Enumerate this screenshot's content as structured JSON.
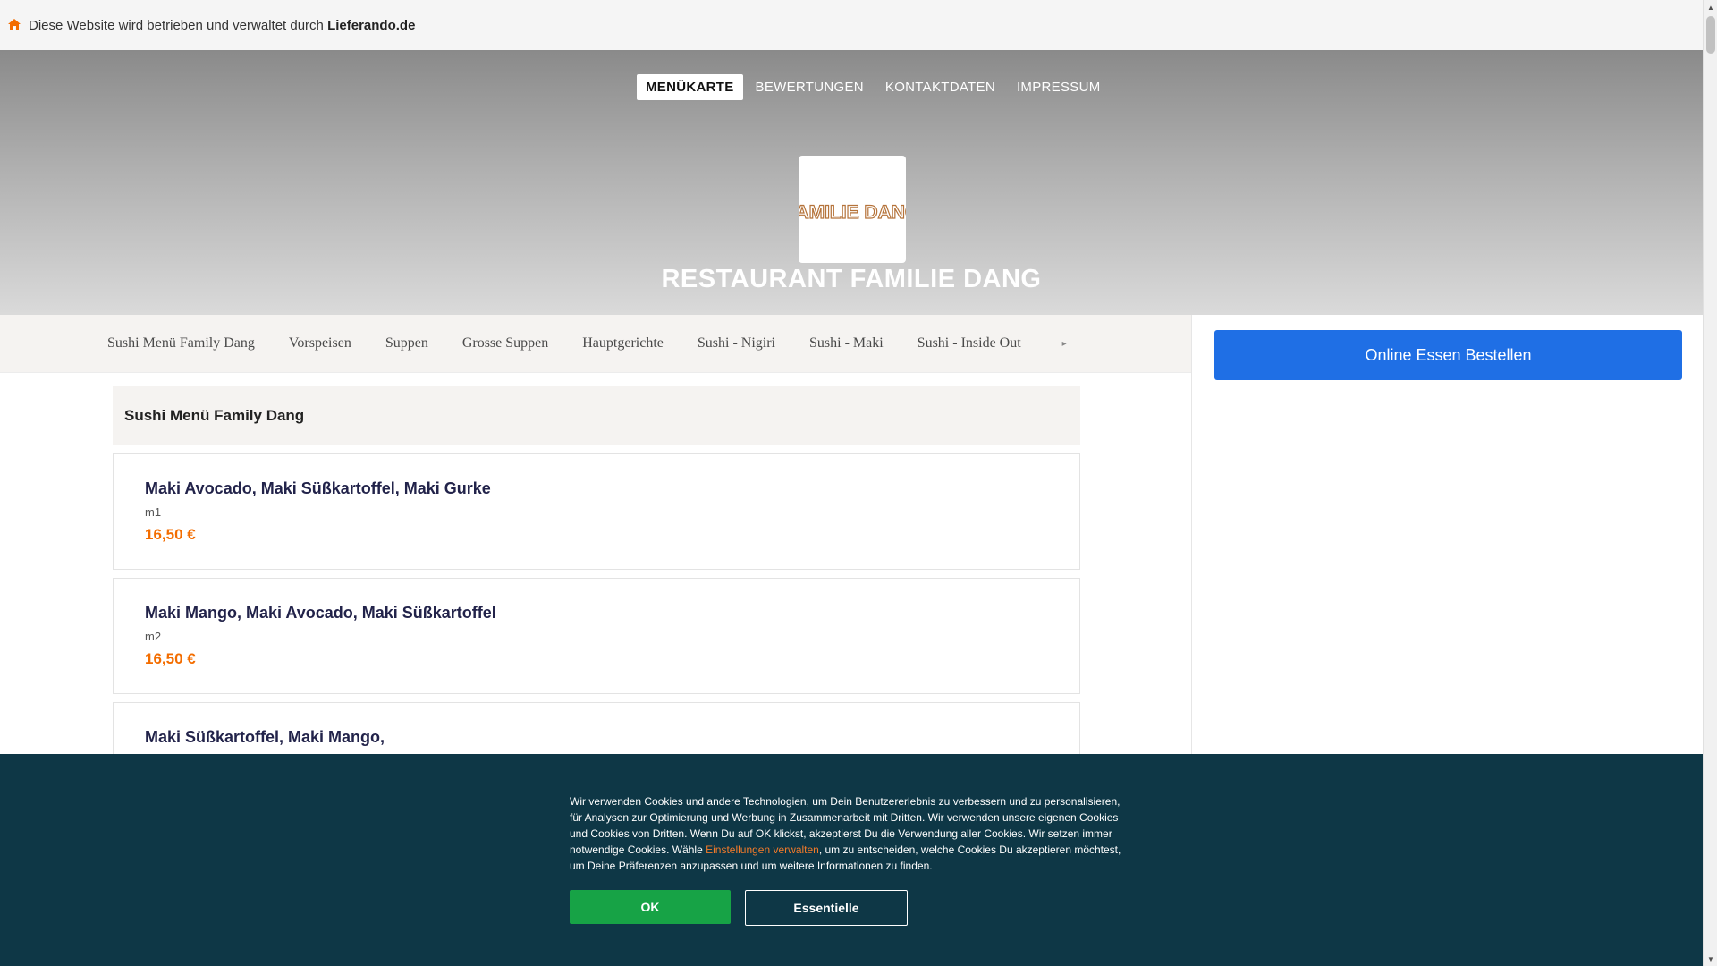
{
  "infobar": {
    "prefix": "Diese Website wird betrieben und verwaltet durch ",
    "brand": "Lieferando.de",
    "icon": "lieferando-home-icon",
    "icon_color": "#f36d00"
  },
  "nav": {
    "items": [
      {
        "label": "MENÜKARTE",
        "active": true
      },
      {
        "label": "BEWERTUNGEN",
        "active": false
      },
      {
        "label": "KONTAKTDATEN",
        "active": false
      },
      {
        "label": "IMPRESSUM",
        "active": false
      }
    ]
  },
  "restaurant": {
    "logo_text": "FAMILIE DANG",
    "name": "RESTAURANT FAMILIE DANG"
  },
  "categories": {
    "items": [
      "Sushi Menü Family Dang",
      "Vorspeisen",
      "Suppen",
      "Grosse Suppen",
      "Hauptgerichte",
      "Sushi - Nigiri",
      "Sushi - Maki",
      "Sushi - Inside Out"
    ],
    "more_icon": "chevron-right-icon"
  },
  "order": {
    "button_label": "Online Essen Bestellen",
    "accent": "#1f6fe5"
  },
  "menu": {
    "section_title": "Sushi Menü Family Dang",
    "items": [
      {
        "name": "Maki Avocado, Maki Süßkartoffel, Maki Gurke",
        "code": "m1",
        "price": "16,50 €"
      },
      {
        "name": "Maki Mango, Maki Avocado, Maki Süßkartoffel",
        "code": "m2",
        "price": "16,50 €"
      },
      {
        "name": "Maki Süßkartoffel, Maki Mango,",
        "code": "",
        "price": ""
      }
    ],
    "price_color": "#f36d00"
  },
  "cookie": {
    "text_before": "Wir verwenden Cookies und andere Technologien, um Dein Benutzererlebnis zu verbessern und zu personalisieren, für Analysen zur Optimierung und Werbung in Zusammenarbeit mit Dritten. Wir verwenden unsere eigenen Cookies und Cookies von Dritten. Wenn Du auf OK klickst, akzeptierst Du die Verwendung aller Cookies. Wir setzen immer notwendige Cookies. Wähle ",
    "link": "Einstellungen verwalten",
    "text_after": ", um zu entscheiden, welche Cookies Du akzeptieren möchtest, um Deine Präferenzen anzupassen und um weitere Informationen zu finden.",
    "ok_label": "OK",
    "essential_label": "Essentielle",
    "background": "#0e3746",
    "ok_color": "#17a346"
  }
}
